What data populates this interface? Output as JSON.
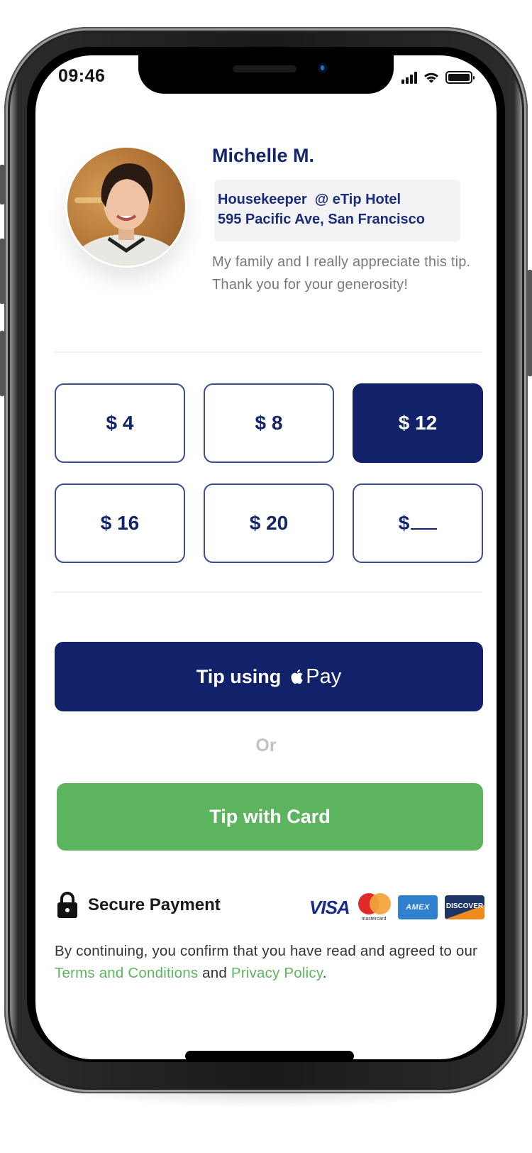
{
  "status_bar": {
    "time": "09:46",
    "icons": [
      "cellular-signal-icon",
      "wifi-icon",
      "battery-icon"
    ]
  },
  "profile": {
    "name": "Michelle M.",
    "role_line": "Housekeeper  @ eTip Hotel",
    "address_line": "595 Pacific Ave, San Francisco",
    "message": "My family and I really appreciate this tip. Thank you for your generosity!",
    "avatar_alt": "Photo of Michelle M."
  },
  "tip_options": [
    {
      "label": "$ 4",
      "amount": 4,
      "selected": false
    },
    {
      "label": "$ 8",
      "amount": 8,
      "selected": false
    },
    {
      "label": "$ 12",
      "amount": 12,
      "selected": true
    },
    {
      "label": "$ 16",
      "amount": 16,
      "selected": false
    },
    {
      "label": "$ 20",
      "amount": 20,
      "selected": false
    },
    {
      "label": "$",
      "amount": null,
      "custom": true,
      "selected": false
    }
  ],
  "actions": {
    "apple_pay_prefix": "Tip using",
    "apple_pay_brand": "Pay",
    "or_label": "Or",
    "card_label": "Tip with Card"
  },
  "security": {
    "label": "Secure Payment",
    "card_brands": [
      "VISA",
      "mastercard",
      "AMEX",
      "DISCOVER"
    ]
  },
  "legal": {
    "prefix": "By continuing, you confirm that you have read and agreed to our",
    "terms_link": "Terms and Conditions",
    "conjunction": "and",
    "privacy_link": "Privacy Policy",
    "suffix": "."
  },
  "colors": {
    "brand_navy": "#11226a",
    "brand_green": "#5cb55e",
    "text_muted": "#7a7a7a"
  }
}
